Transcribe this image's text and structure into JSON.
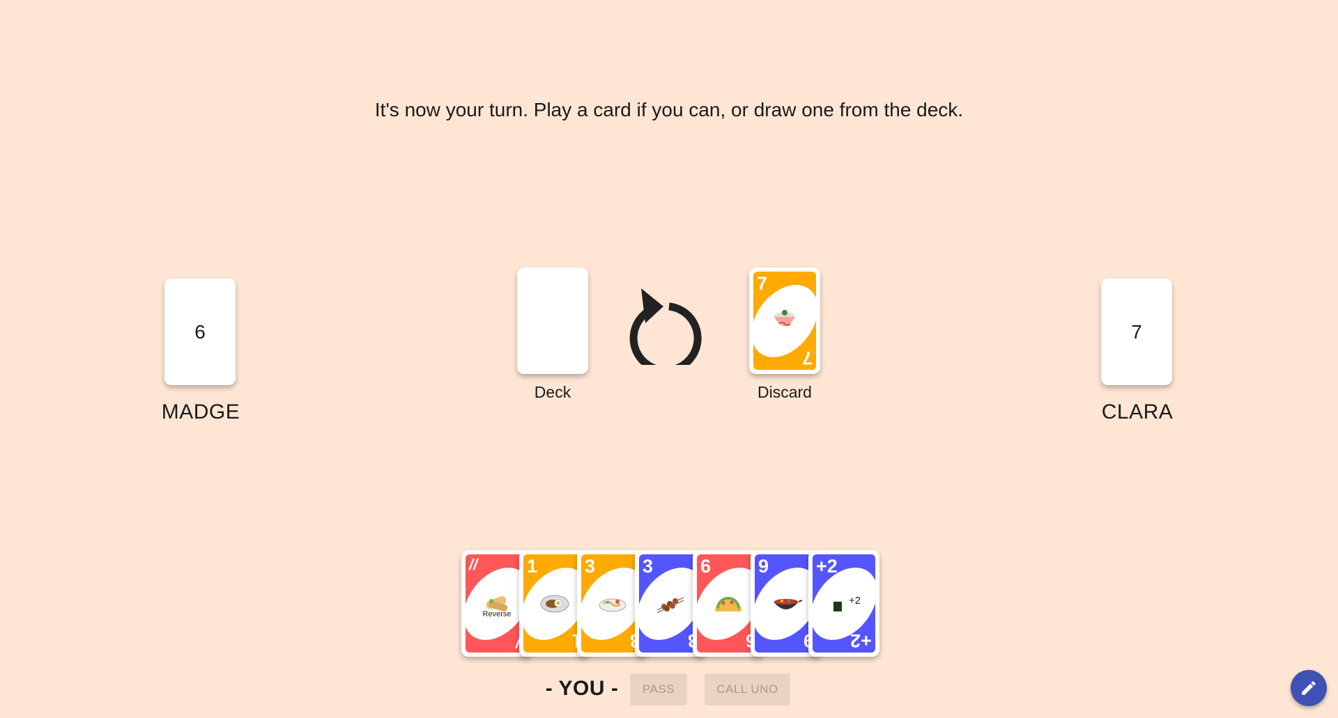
{
  "status_message": "It's now your turn. Play a card if you can, or draw one from the deck.",
  "opponents": [
    {
      "name": "MADGE",
      "card_count": "6"
    },
    {
      "name": "CLARA",
      "card_count": "7"
    }
  ],
  "piles": {
    "deck_label": "Deck",
    "discard_label": "Discard",
    "discard_top": {
      "corner": "7",
      "color": "#ffaa00",
      "food": "soup-bowl"
    }
  },
  "direction_icon": "rotate-counterclockwise-icon",
  "hand": [
    {
      "corner": "//",
      "color": "#ff5757",
      "food": "burrito",
      "caption": "Reverse"
    },
    {
      "corner": "1",
      "color": "#ffaa00",
      "food": "plate-egg",
      "caption": ""
    },
    {
      "corner": "3",
      "color": "#ffaa00",
      "food": "noodle-plate",
      "caption": ""
    },
    {
      "corner": "3",
      "color": "#5555fd",
      "food": "skewers",
      "caption": ""
    },
    {
      "corner": "6",
      "color": "#ff5757",
      "food": "taco",
      "caption": ""
    },
    {
      "corner": "9",
      "color": "#5555fd",
      "food": "wok",
      "caption": ""
    },
    {
      "corner": "+2",
      "color": "#5555fd",
      "food": "nori-plus-two",
      "caption": "+2"
    }
  ],
  "player_label": "- YOU -",
  "buttons": {
    "pass": "PASS",
    "call_uno": "CALL UNO"
  },
  "fab_icon": "pencil-icon",
  "colors": {
    "background": "#ffe6d4",
    "red": "#ff5757",
    "yellow": "#ffaa00",
    "blue": "#5555fd",
    "fab": "#3f51b5"
  }
}
